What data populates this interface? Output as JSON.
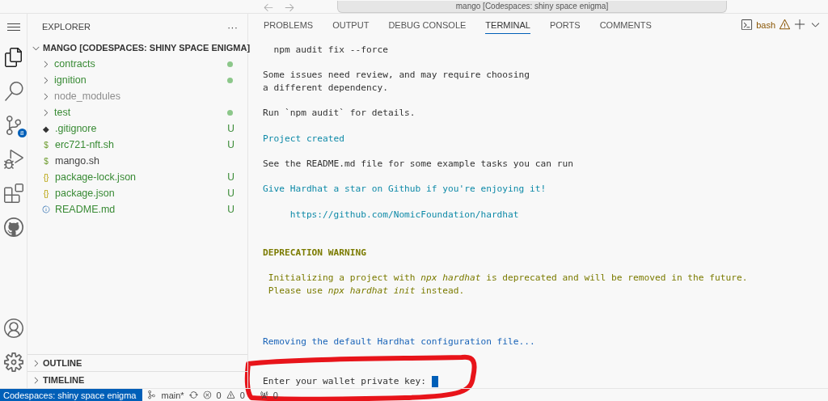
{
  "title_bar": {
    "search": "mango [Codespaces: shiny space enigma]"
  },
  "activity_bar": {
    "items": [
      {
        "selected": true
      },
      {
        "selected": false
      },
      {
        "selected": false,
        "badge": "8"
      },
      {
        "selected": false
      },
      {
        "selected": false
      },
      {
        "selected": false
      }
    ]
  },
  "sidebar": {
    "title": "EXPLORER",
    "more": "···",
    "root": {
      "name": "MANGO [CODESPACES: SHINY SPACE ENIGMA]",
      "expanded": true
    },
    "items": [
      {
        "kind": "folder",
        "name": "contracts",
        "expanded": false,
        "untracked": true,
        "ignored": false
      },
      {
        "kind": "folder",
        "name": "ignition",
        "expanded": false,
        "untracked": true,
        "ignored": false
      },
      {
        "kind": "folder",
        "name": "node_modules",
        "expanded": false,
        "untracked": false,
        "ignored": true
      },
      {
        "kind": "folder",
        "name": "test",
        "expanded": false,
        "untracked": true,
        "ignored": false
      },
      {
        "kind": "config",
        "glyph": "◆",
        "name": ".gitignore",
        "untracked": true,
        "status": "U"
      },
      {
        "kind": "script",
        "glyph": "$",
        "name": "erc721-nft.sh",
        "untracked": true,
        "status": "U"
      },
      {
        "kind": "script",
        "glyph": "$",
        "name": "mango.sh",
        "untracked": false
      },
      {
        "kind": "data",
        "glyph": "{}",
        "name": "package-lock.json",
        "untracked": true,
        "status": "U"
      },
      {
        "kind": "data",
        "glyph": "{}",
        "name": "package.json",
        "untracked": true,
        "status": "U"
      },
      {
        "kind": "doc",
        "name": "README.md",
        "untracked": true,
        "status": "U"
      }
    ],
    "sections": [
      {
        "label": "OUTLINE",
        "expanded": false
      },
      {
        "label": "TIMELINE",
        "expanded": false
      }
    ]
  },
  "panel": {
    "tabs": [
      {
        "label": "PROBLEMS",
        "selected": false
      },
      {
        "label": "OUTPUT",
        "selected": false
      },
      {
        "label": "DEBUG CONSOLE",
        "selected": false
      },
      {
        "label": "TERMINAL",
        "selected": true
      },
      {
        "label": "PORTS",
        "selected": false
      },
      {
        "label": "COMMENTS",
        "selected": false
      }
    ],
    "terminal_name": "bash",
    "terminal": [
      {
        "kind": "output",
        "lines": [
          "  npm audit fix --force"
        ]
      },
      {
        "kind": "output",
        "lines": [
          "Some issues need review, and may require choosing",
          "a different dependency."
        ]
      },
      {
        "kind": "output",
        "lines": [
          "Run `npm audit` for details."
        ]
      },
      {
        "kind": "success",
        "lines": [
          "Project created"
        ]
      },
      {
        "kind": "output",
        "lines": [
          "See the README.md file for some example tasks you can run"
        ]
      },
      {
        "kind": "success",
        "lines": [
          "Give Hardhat a star on Github if you're enjoying it!"
        ]
      },
      {
        "kind": "link",
        "lines": [
          "     https://github.com/NomicFoundation/hardhat"
        ]
      },
      {
        "kind": "warning-title",
        "lines": [
          "DEPRECATION WARNING"
        ]
      },
      {
        "kind": "warning",
        "lines": [
          " Initializing a project with *npx hardhat* is deprecated and will be removed in the future.",
          " Please use *npx hardhat init* instead."
        ]
      },
      {
        "kind": "info",
        "lines": [
          "Removing the default Hardhat configuration file..."
        ]
      },
      {
        "kind": "prompt",
        "lines": [
          "Enter your wallet private key: "
        ]
      }
    ]
  },
  "status_bar": {
    "remote": "Codespaces: shiny space enigma",
    "branch": "main*",
    "errors": "0",
    "warnings": "0",
    "ports": "0"
  }
}
